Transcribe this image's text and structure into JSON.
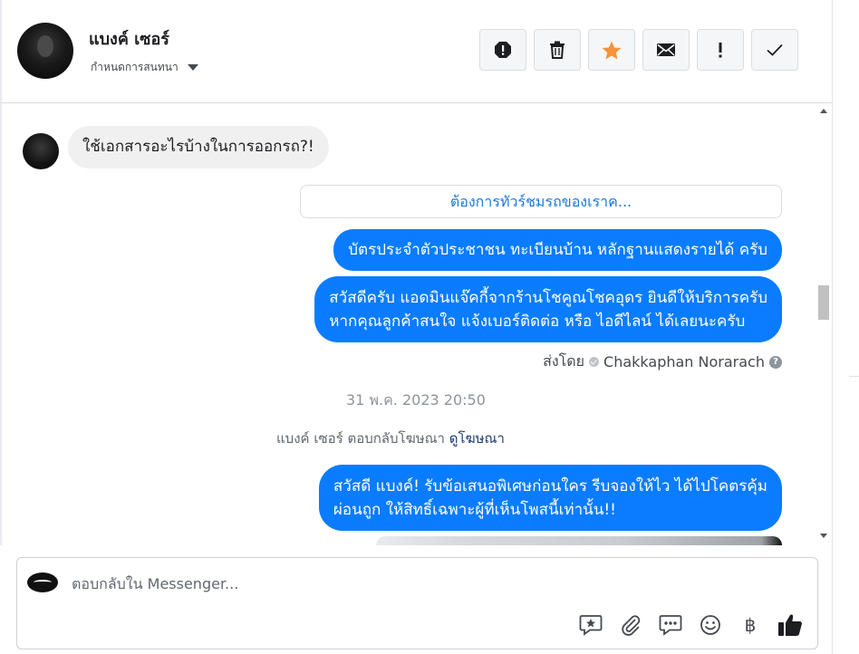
{
  "header": {
    "contact_name": "แบงค์ เซอร์",
    "assign_label": "กำหนดการสนทนา",
    "actions": [
      {
        "name": "spam-button",
        "icon": "octagon-alert-icon"
      },
      {
        "name": "delete-button",
        "icon": "trash-icon"
      },
      {
        "name": "star-button",
        "icon": "star-icon",
        "color": "#f7923b"
      },
      {
        "name": "mark-unread-button",
        "icon": "envelope-icon"
      },
      {
        "name": "follow-up-button",
        "icon": "exclamation-icon"
      },
      {
        "name": "mark-done-button",
        "icon": "checkmark-icon"
      }
    ]
  },
  "thread": {
    "incoming_message": "ใช้เอกสารอะไรบ้างในการออกรถ?!",
    "quick_reply": "ต้องการทัวร์ชมรถของเราค...",
    "outgoing_1": "บัตรประจำตัวประชาชน ทะเบียนบ้าน หลักฐานแสดงรายได้ ครับ",
    "outgoing_2_line1": "สวัสดีครับ แอดมินแจ๊คกี้จากร้านโชคูณโชคอุดร ยินดีให้บริการครับ",
    "outgoing_2_line2": "หากคุณลูกค้าสนใจ แจ้งเบอร์ติดต่อ หรือ ไอดีไลน์ ได้เลยนะครับ",
    "sent_by_label": "ส่งโดย",
    "sent_by_name": "Chakkaphan Norarach",
    "help_glyph": "?",
    "timestamp": "31 พ.ค. 2023 20:50",
    "ad_reply_text": "แบงค์ เซอร์ ตอบกลับโฆษณา",
    "ad_link": "ดูโฆษณา",
    "outgoing_3_line1": "สวัสดี แบงค์! รับข้อเสนอพิเศษก่อนใคร รีบจองให้ไว ได้ไปโคตรคุ้ม",
    "outgoing_3_line2": "ผ่อนถูก ให้สิทธิ์เฉพาะผู้ที่เห็นโพสนี้เท่านั้น!!"
  },
  "composer": {
    "placeholder": "ตอบกลับใน Messenger...",
    "tools": [
      {
        "name": "saved-reply-button",
        "icon": "chat-star-icon"
      },
      {
        "name": "attach-button",
        "icon": "paperclip-icon"
      },
      {
        "name": "message-template-button",
        "icon": "chat-dots-icon"
      },
      {
        "name": "emoji-button",
        "icon": "smiley-icon"
      },
      {
        "name": "payment-button",
        "icon": "baht-icon",
        "glyph": "฿"
      },
      {
        "name": "like-button",
        "icon": "thumbs-up-icon"
      }
    ]
  },
  "colors": {
    "outgoing_bubble": "#0a7cff",
    "incoming_bubble": "#f0f0f0",
    "link": "#1c78d7",
    "star": "#f7923b"
  }
}
